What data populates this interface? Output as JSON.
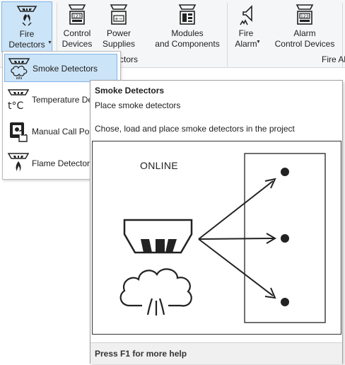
{
  "ribbon": {
    "buttons": [
      {
        "label": "Fire\nDetectors",
        "icon": "smoke-detector-icon",
        "active": true
      },
      {
        "label": "Control\nDevices",
        "icon": "control-panel-icon"
      },
      {
        "label": "Power\nSupplies",
        "icon": "power-supply-icon"
      },
      {
        "label": "Modules\nand Components",
        "icon": "module-icon"
      },
      {
        "label": "Fire\nAlarm",
        "icon": "sounder-icon"
      },
      {
        "label": "Alarm\nControl Devices",
        "icon": "alarm-control-icon"
      }
    ],
    "group_labels": [
      "ctors",
      "Fire Al"
    ]
  },
  "menu": {
    "items": [
      {
        "label": "Smoke Detectors",
        "icon": "smoke-detector-icon",
        "highlighted": true
      },
      {
        "label": "Temperature De",
        "icon": "temperature-detector-icon"
      },
      {
        "label": "Manual Call Poi",
        "icon": "manual-call-point-icon"
      },
      {
        "label": "Flame Detectors",
        "icon": "flame-detector-icon"
      }
    ]
  },
  "tooltip": {
    "title": "Smoke Detectors",
    "subtitle": "Place smoke detectors",
    "description": "Chose, load and place smoke detectors in the project",
    "image_label": "ONLINE",
    "help": "Press F1 for more help"
  },
  "colors": {
    "highlight": "#cce4f7",
    "highlight_border": "#7eb4ea",
    "ribbon_bg": "#f5f6f7"
  }
}
